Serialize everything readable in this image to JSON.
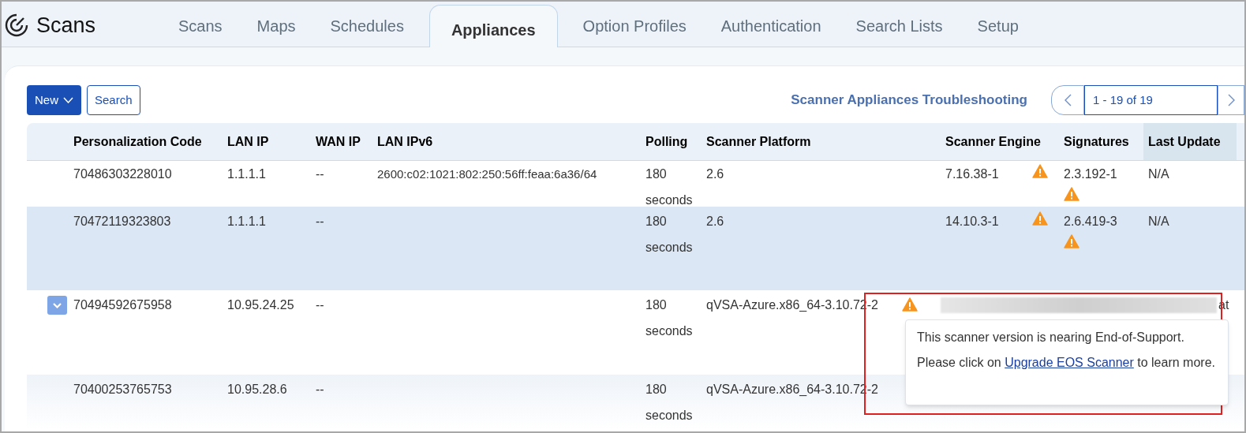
{
  "app": {
    "title": "Scans"
  },
  "tabs": [
    {
      "label": "Scans",
      "selected": false
    },
    {
      "label": "Maps",
      "selected": false
    },
    {
      "label": "Schedules",
      "selected": false
    },
    {
      "label": "Appliances",
      "selected": true
    },
    {
      "label": "Option Profiles",
      "selected": false
    },
    {
      "label": "Authentication",
      "selected": false
    },
    {
      "label": "Search Lists",
      "selected": false
    },
    {
      "label": "Setup",
      "selected": false
    }
  ],
  "toolbar": {
    "new_button": "New",
    "search_button": "Search",
    "troubleshooting_link": "Scanner Appliances Troubleshooting",
    "pagination": {
      "range": "1 - 19 of 19"
    }
  },
  "table": {
    "columns": [
      {
        "sorted": false
      },
      {
        "label": "Personalization Code",
        "sorted": false
      },
      {
        "label": "LAN IP",
        "sorted": false
      },
      {
        "label": "WAN IP",
        "sorted": false
      },
      {
        "label": "LAN IPv6",
        "sorted": false
      },
      {
        "label": "Polling",
        "sorted": false
      },
      {
        "label": "Scanner Platform",
        "sorted": false
      },
      {
        "label": "Scanner Engine",
        "sorted": false
      },
      {
        "label": "Signatures",
        "sorted": false
      },
      {
        "label": "Last Update",
        "sorted": true
      }
    ],
    "rows": [
      {
        "code": "70486303228010",
        "lan_ip": "1.1.1.1",
        "wan_ip": "--",
        "lan_ipv6": "2600:c02:1021:802:250:56ff:feaa:6a36/64",
        "polling": "180 seconds",
        "platform": "2.6",
        "engine": "7.16.38-1",
        "engine_warning": true,
        "signatures": "2.3.192-1",
        "signatures_warning": true,
        "last_update": "N/A",
        "selected": false,
        "expander": false,
        "redacted": false
      },
      {
        "code": "70472119323803",
        "lan_ip": "1.1.1.1",
        "wan_ip": "--",
        "polling": "180 seconds",
        "platform": "2.6",
        "engine": "14.10.3-1",
        "engine_warning": true,
        "signatures": "2.6.419-3",
        "signatures_warning": true,
        "last_update": "N/A",
        "selected": true,
        "expander": false,
        "redacted": false
      },
      {
        "code": "70494592675958",
        "lan_ip": "10.95.24.25",
        "wan_ip": "--",
        "polling": "180 seconds",
        "platform": "qVSA-Azure.x86_64-3.10.72-2",
        "engine_warning": true,
        "trailing": "at",
        "selected": false,
        "expander": true,
        "redacted": true
      },
      {
        "code": "70400253765753",
        "lan_ip": "10.95.28.6",
        "wan_ip": "--",
        "polling": "180 seconds",
        "platform": "qVSA-Azure.x86_64-3.10.72-2",
        "selected": false,
        "expander": false
      }
    ]
  },
  "tooltip": {
    "before": "This scanner version is nearing End-of-Support. Please click on ",
    "link": "Upgrade EOS Scanner",
    "after": " to learn more."
  }
}
